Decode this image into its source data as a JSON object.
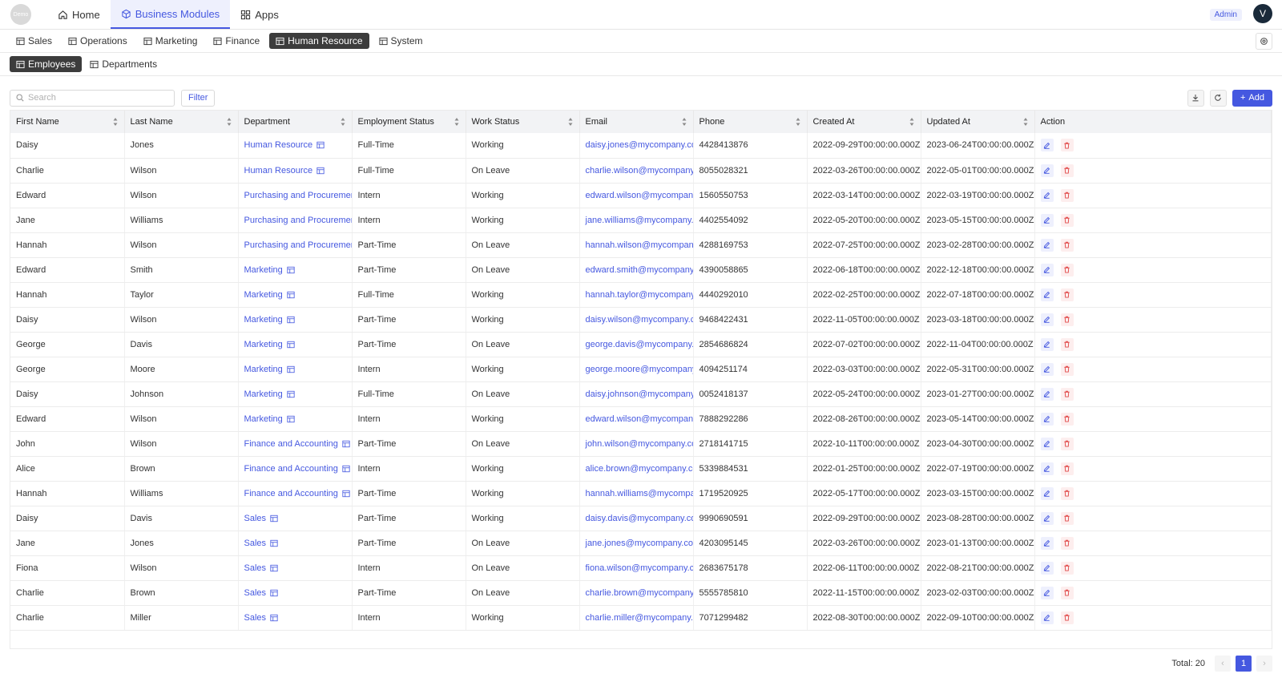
{
  "app": {
    "logo_text": "Demo",
    "user_initial": "V",
    "role_badge": "Admin"
  },
  "topnav": [
    {
      "label": "Home",
      "icon": "home-icon"
    },
    {
      "label": "Business Modules",
      "icon": "cube-icon",
      "active": true
    },
    {
      "label": "Apps",
      "icon": "apps-icon"
    }
  ],
  "modules": [
    "Sales",
    "Operations",
    "Marketing",
    "Finance",
    "Human Resource",
    "System"
  ],
  "active_module": "Human Resource",
  "subtabs": [
    "Employees",
    "Departments"
  ],
  "active_subtab": "Employees",
  "toolbar": {
    "search_placeholder": "Search",
    "filter_label": "Filter",
    "add_label": "Add"
  },
  "table": {
    "columns": [
      "First Name",
      "Last Name",
      "Department",
      "Employment Status",
      "Work Status",
      "Email",
      "Phone",
      "Created At",
      "Updated At",
      "Action"
    ],
    "rows": [
      [
        "Daisy",
        "Jones",
        "Human Resource",
        "Full-Time",
        "Working",
        "daisy.jones@mycompany.com",
        "4428413876",
        "2022-09-29T00:00:00.000Z",
        "2023-06-24T00:00:00.000Z"
      ],
      [
        "Charlie",
        "Wilson",
        "Human Resource",
        "Full-Time",
        "On Leave",
        "charlie.wilson@mycompany.com",
        "8055028321",
        "2022-03-26T00:00:00.000Z",
        "2022-05-01T00:00:00.000Z"
      ],
      [
        "Edward",
        "Wilson",
        "Purchasing and Procurement",
        "Intern",
        "Working",
        "edward.wilson@mycompany.com",
        "1560550753",
        "2022-03-14T00:00:00.000Z",
        "2022-03-19T00:00:00.000Z"
      ],
      [
        "Jane",
        "Williams",
        "Purchasing and Procurement",
        "Intern",
        "Working",
        "jane.williams@mycompany.com",
        "4402554092",
        "2022-05-20T00:00:00.000Z",
        "2023-05-15T00:00:00.000Z"
      ],
      [
        "Hannah",
        "Wilson",
        "Purchasing and Procurement",
        "Part-Time",
        "On Leave",
        "hannah.wilson@mycompany.com",
        "4288169753",
        "2022-07-25T00:00:00.000Z",
        "2023-02-28T00:00:00.000Z"
      ],
      [
        "Edward",
        "Smith",
        "Marketing",
        "Part-Time",
        "On Leave",
        "edward.smith@mycompany.com",
        "4390058865",
        "2022-06-18T00:00:00.000Z",
        "2022-12-18T00:00:00.000Z"
      ],
      [
        "Hannah",
        "Taylor",
        "Marketing",
        "Full-Time",
        "Working",
        "hannah.taylor@mycompany.com",
        "4440292010",
        "2022-02-25T00:00:00.000Z",
        "2022-07-18T00:00:00.000Z"
      ],
      [
        "Daisy",
        "Wilson",
        "Marketing",
        "Part-Time",
        "Working",
        "daisy.wilson@mycompany.com",
        "9468422431",
        "2022-11-05T00:00:00.000Z",
        "2023-03-18T00:00:00.000Z"
      ],
      [
        "George",
        "Davis",
        "Marketing",
        "Part-Time",
        "On Leave",
        "george.davis@mycompany.com",
        "2854686824",
        "2022-07-02T00:00:00.000Z",
        "2022-11-04T00:00:00.000Z"
      ],
      [
        "George",
        "Moore",
        "Marketing",
        "Intern",
        "Working",
        "george.moore@mycompany.com",
        "4094251174",
        "2022-03-03T00:00:00.000Z",
        "2022-05-31T00:00:00.000Z"
      ],
      [
        "Daisy",
        "Johnson",
        "Marketing",
        "Full-Time",
        "On Leave",
        "daisy.johnson@mycompany.com",
        "0052418137",
        "2022-05-24T00:00:00.000Z",
        "2023-01-27T00:00:00.000Z"
      ],
      [
        "Edward",
        "Wilson",
        "Marketing",
        "Intern",
        "Working",
        "edward.wilson@mycompany.com",
        "7888292286",
        "2022-08-26T00:00:00.000Z",
        "2023-05-14T00:00:00.000Z"
      ],
      [
        "John",
        "Wilson",
        "Finance and Accounting",
        "Part-Time",
        "On Leave",
        "john.wilson@mycompany.com",
        "2718141715",
        "2022-10-11T00:00:00.000Z",
        "2023-04-30T00:00:00.000Z"
      ],
      [
        "Alice",
        "Brown",
        "Finance and Accounting",
        "Intern",
        "Working",
        "alice.brown@mycompany.com",
        "5339884531",
        "2022-01-25T00:00:00.000Z",
        "2022-07-19T00:00:00.000Z"
      ],
      [
        "Hannah",
        "Williams",
        "Finance and Accounting",
        "Part-Time",
        "Working",
        "hannah.williams@mycompany.com",
        "1719520925",
        "2022-05-17T00:00:00.000Z",
        "2023-03-15T00:00:00.000Z"
      ],
      [
        "Daisy",
        "Davis",
        "Sales",
        "Part-Time",
        "Working",
        "daisy.davis@mycompany.com",
        "9990690591",
        "2022-09-29T00:00:00.000Z",
        "2023-08-28T00:00:00.000Z"
      ],
      [
        "Jane",
        "Jones",
        "Sales",
        "Part-Time",
        "On Leave",
        "jane.jones@mycompany.com",
        "4203095145",
        "2022-03-26T00:00:00.000Z",
        "2023-01-13T00:00:00.000Z"
      ],
      [
        "Fiona",
        "Wilson",
        "Sales",
        "Intern",
        "On Leave",
        "fiona.wilson@mycompany.com",
        "2683675178",
        "2022-06-11T00:00:00.000Z",
        "2022-08-21T00:00:00.000Z"
      ],
      [
        "Charlie",
        "Brown",
        "Sales",
        "Part-Time",
        "On Leave",
        "charlie.brown@mycompany.com",
        "5555785810",
        "2022-11-15T00:00:00.000Z",
        "2023-02-03T00:00:00.000Z"
      ],
      [
        "Charlie",
        "Miller",
        "Sales",
        "Intern",
        "Working",
        "charlie.miller@mycompany.com",
        "7071299482",
        "2022-08-30T00:00:00.000Z",
        "2022-09-10T00:00:00.000Z"
      ]
    ]
  },
  "pagination": {
    "total_label": "Total: 20",
    "current_page": "1",
    "prev": "‹",
    "next": "›"
  },
  "colors": {
    "accent": "#4558e0",
    "dark_tab": "#3c3c3c",
    "delete": "#e04545"
  }
}
